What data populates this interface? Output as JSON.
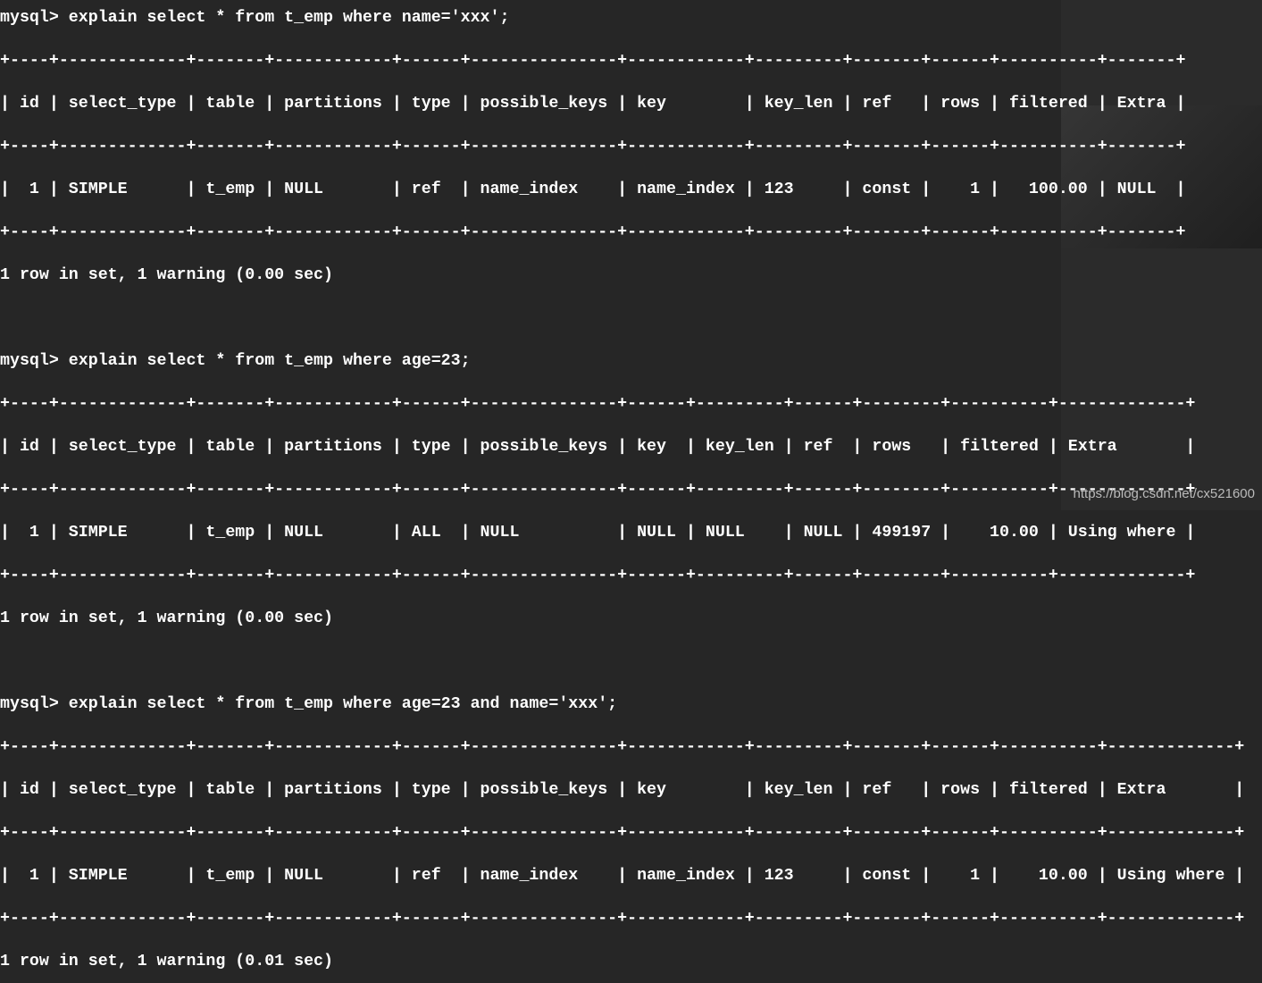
{
  "prompt": "mysql> ",
  "watermark": "https://blog.csdn.net/cx521600",
  "queries": [
    {
      "sql": "explain select * from t_emp where name='xxx';",
      "headers": [
        "id",
        "select_type",
        "table",
        "partitions",
        "type",
        "possible_keys",
        "key",
        "key_len",
        "ref",
        "rows",
        "filtered",
        "Extra"
      ],
      "rows": [
        [
          "1",
          "SIMPLE",
          "t_emp",
          "NULL",
          "ref",
          "name_index",
          "name_index",
          "123",
          "const",
          "1",
          "100.00",
          "NULL"
        ]
      ],
      "footer": "1 row in set, 1 warning (0.00 sec)"
    },
    {
      "sql": "explain select * from t_emp where age=23;",
      "headers": [
        "id",
        "select_type",
        "table",
        "partitions",
        "type",
        "possible_keys",
        "key",
        "key_len",
        "ref",
        "rows",
        "filtered",
        "Extra"
      ],
      "rows": [
        [
          "1",
          "SIMPLE",
          "t_emp",
          "NULL",
          "ALL",
          "NULL",
          "NULL",
          "NULL",
          "NULL",
          "499197",
          "10.00",
          "Using where"
        ]
      ],
      "footer": "1 row in set, 1 warning (0.00 sec)"
    },
    {
      "sql": "explain select * from t_emp where age=23 and name='xxx';",
      "headers": [
        "id",
        "select_type",
        "table",
        "partitions",
        "type",
        "possible_keys",
        "key",
        "key_len",
        "ref",
        "rows",
        "filtered",
        "Extra"
      ],
      "rows": [
        [
          "1",
          "SIMPLE",
          "t_emp",
          "NULL",
          "ref",
          "name_index",
          "name_index",
          "123",
          "const",
          "1",
          "10.00",
          "Using where"
        ]
      ],
      "footer": "1 row in set, 1 warning (0.01 sec)"
    }
  ]
}
